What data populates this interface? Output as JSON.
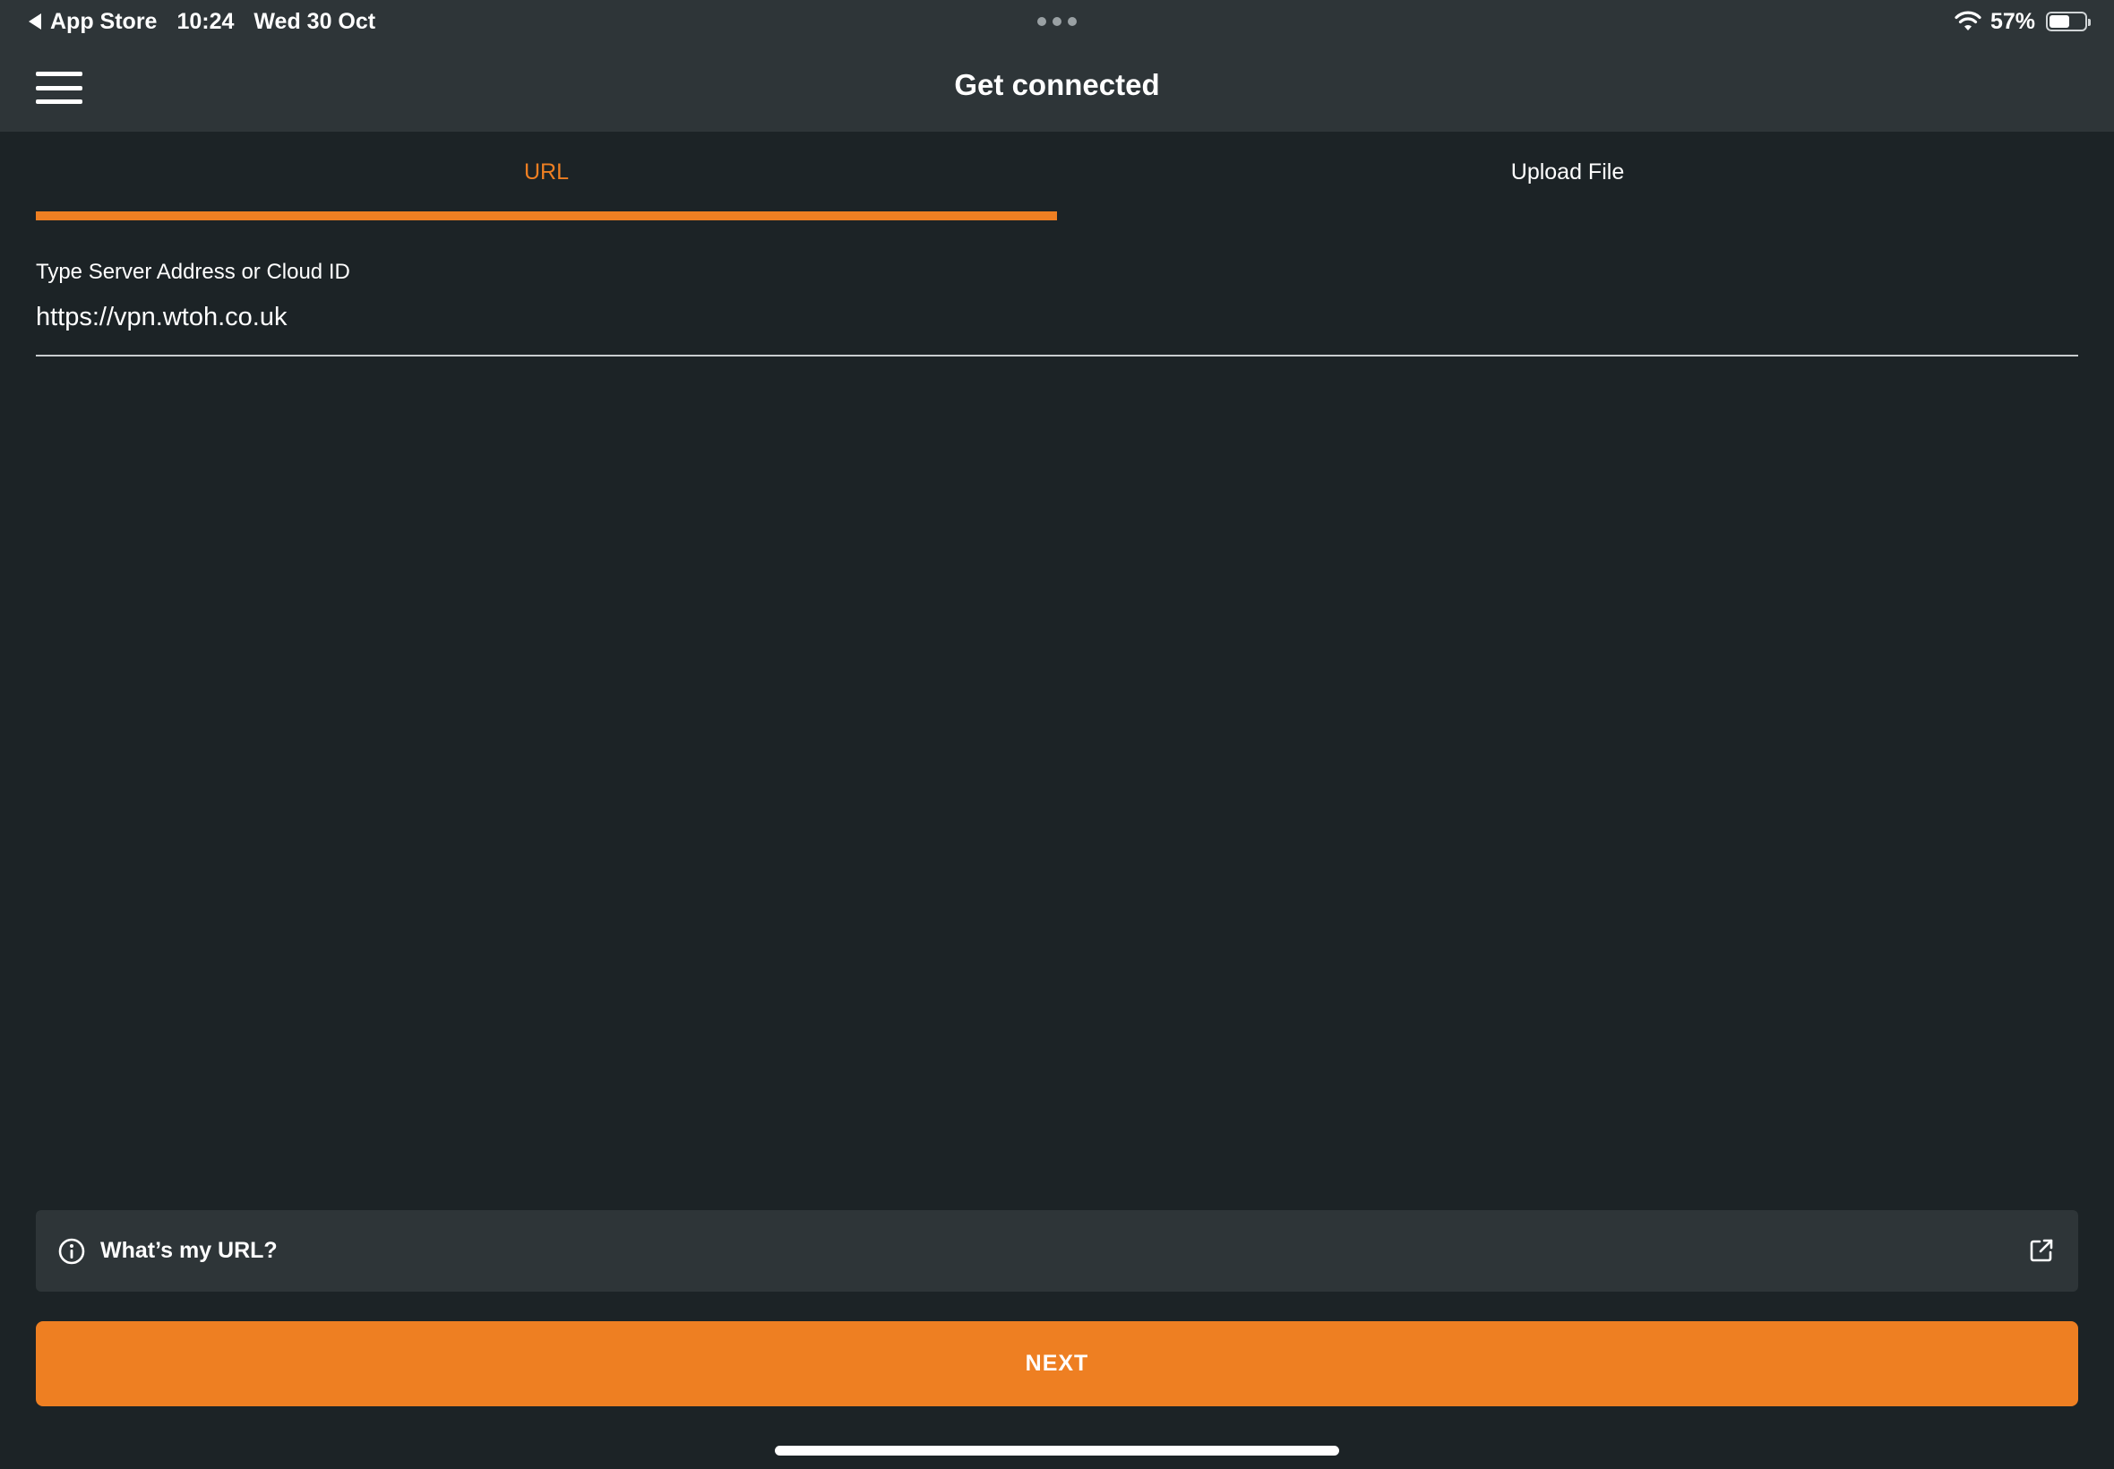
{
  "status_bar": {
    "back_app": "App Store",
    "time": "10:24",
    "date": "Wed 30 Oct",
    "battery_percent": "57%",
    "battery_level": 0.57,
    "icons": [
      "back-arrow-icon",
      "more-dots-icon",
      "wifi-icon",
      "battery-icon"
    ]
  },
  "header": {
    "title": "Get connected",
    "menu_icon": "hamburger-menu-icon"
  },
  "tabs": [
    {
      "label": "URL",
      "active": true
    },
    {
      "label": "Upload File",
      "active": false
    }
  ],
  "form": {
    "label": "Type Server Address or Cloud ID",
    "value": "https://vpn.wtoh.co.uk"
  },
  "help": {
    "text": "What’s my URL?",
    "left_icon": "info-icon",
    "right_icon": "external-link-icon"
  },
  "next_button": {
    "label": "NEXT"
  },
  "colors": {
    "accent": "#ee7f22",
    "background": "#1c2326",
    "surface": "#2e3538",
    "text": "#ffffff"
  }
}
